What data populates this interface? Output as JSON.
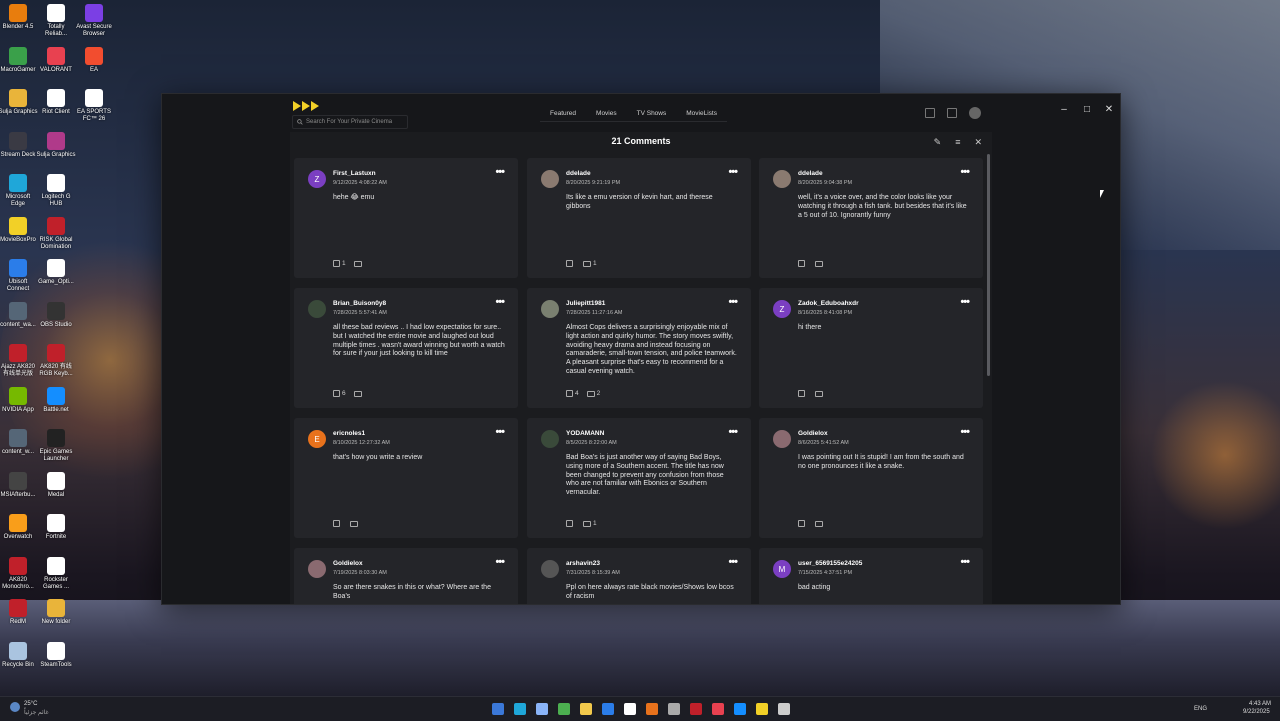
{
  "desktop_icons": [
    {
      "label": "Blender 4.5",
      "color": "#e87d0d"
    },
    {
      "label": "Totally Reliab...",
      "color": "#ffffff"
    },
    {
      "label": "Avast Secure Browser",
      "color": "#7b3fe4"
    },
    {
      "label": "MacroGamer",
      "color": "#3aa04a"
    },
    {
      "label": "VALORANT",
      "color": "#e84150"
    },
    {
      "label": "EA",
      "color": "#f24d2f"
    },
    {
      "label": "Sulja Graphics",
      "color": "#e9b43a"
    },
    {
      "label": "Riot Client",
      "color": "#ffffff"
    },
    {
      "label": "EA SPORTS FC™ 26",
      "color": "#ffffff"
    },
    {
      "label": "Stream Deck",
      "color": "#3a3a44"
    },
    {
      "label": "Sulja Graphics",
      "color": "#b03a8a"
    },
    {
      "label": "Microsoft Edge",
      "color": "#1fa7d9"
    },
    {
      "label": "Logitech G HUB",
      "color": "#ffffff"
    },
    {
      "label": "MovieBoxPro",
      "color": "#f2d027"
    },
    {
      "label": "RISK Global Domination",
      "color": "#c0202a"
    },
    {
      "label": "Ubisoft Connect",
      "color": "#2b7de9"
    },
    {
      "label": "Game_Opti...",
      "color": "#ffffff"
    },
    {
      "label": "content_wa...",
      "color": "#556677"
    },
    {
      "label": "OBS Studio",
      "color": "#333333"
    },
    {
      "label": "Ajazz AK820 有线单光版",
      "color": "#c0202a"
    },
    {
      "label": "AK820 有线 RGB Keyb...",
      "color": "#c0202a"
    },
    {
      "label": "NVIDIA App",
      "color": "#76b900"
    },
    {
      "label": "Battle.net",
      "color": "#148eff"
    },
    {
      "label": "content_w...",
      "color": "#556677"
    },
    {
      "label": "Epic Games Launcher",
      "color": "#222222"
    },
    {
      "label": "MSIAfterbu...",
      "color": "#444444"
    },
    {
      "label": "Medal",
      "color": "#ffffff"
    },
    {
      "label": "Overwatch",
      "color": "#f99e1a"
    },
    {
      "label": "Fortnite",
      "color": "#ffffff"
    },
    {
      "label": "AK820 Monochro...",
      "color": "#c0202a"
    },
    {
      "label": "Rockster Games ...",
      "color": "#ffffff"
    },
    {
      "label": "RedM",
      "color": "#c0202a"
    },
    {
      "label": "New folder",
      "color": "#e9b43a"
    },
    {
      "label": "Recycle Bin",
      "color": "#aac4e0"
    },
    {
      "label": "SteamTools",
      "color": "#ffffff"
    }
  ],
  "app": {
    "search_placeholder": "Search For Your Private Cinema",
    "nav_tabs": [
      "Featured",
      "Movies",
      "TV Shows",
      "MovieLists"
    ],
    "window_controls": {
      "minimize": "–",
      "maximize": "□",
      "close": "✕"
    },
    "accent": "#f2d027"
  },
  "comments_panel": {
    "title": "21 Comments",
    "icons": {
      "edit": "✎",
      "sort": "≡",
      "close": "✕"
    }
  },
  "comments": [
    {
      "user": "First_Lastuxn",
      "date": "9/12/2025 4:08:22 AM",
      "text": "hehe 😂 emu",
      "likes": "1",
      "replies": "",
      "avatar_letter": "Z",
      "avatar_color": "#7b3fc2"
    },
    {
      "user": "ddelade",
      "date": "8/20/2025 9:21:19 PM",
      "text": "Its like a emu version of kevin hart, and therese gibbons",
      "likes": "",
      "replies": "1",
      "avatar_letter": "",
      "avatar_color": "#8a7a70"
    },
    {
      "user": "ddelade",
      "date": "8/20/2025 9:04:38 PM",
      "text": "well, it's a voice over, and the color looks like your watching it through a fish tank. but besides that it's like a 5 out of 10. Ignorantly funny",
      "likes": "",
      "replies": "",
      "avatar_letter": "",
      "avatar_color": "#8a7a70"
    },
    {
      "user": "Brian_Buison0y8",
      "date": "7/28/2025 5:57:41 AM",
      "text": "all these bad reviews .. I had low expectatios  for sure.. but I watched the entire movie and laughed out loud multiple times . wasn't award winning but worth a watch for sure if your just looking to kill time",
      "likes": "6",
      "replies": "",
      "avatar_letter": "",
      "avatar_color": "#3a4a3a"
    },
    {
      "user": "Juliepitt1981",
      "date": "7/28/2025 11:27:16 AM",
      "text": "Almost Cops delivers a surprisingly enjoyable mix of light action and quirky humor. The story moves swiftly, avoiding heavy drama and instead focusing on camaraderie, small-town tension, and police teamwork. A pleasant surprise that's easy to recommend for a casual evening watch.",
      "likes": "4",
      "replies": "2",
      "avatar_letter": "",
      "avatar_color": "#7a8070"
    },
    {
      "user": "Zadok_Eduboahxdr",
      "date": "8/16/2025 8:41:08 PM",
      "text": "hi there",
      "likes": "",
      "replies": "",
      "avatar_letter": "Z",
      "avatar_color": "#7b3fc2"
    },
    {
      "user": "ericnoles1",
      "date": "8/10/2025 12:27:32 AM",
      "text": "that's how you write a review",
      "likes": "",
      "replies": "",
      "avatar_letter": "E",
      "avatar_color": "#e8721c"
    },
    {
      "user": "YODAMANN",
      "date": "8/5/2025 8:22:00 AM",
      "text": "Bad Boa's is just another way of saying Bad Boys, using more of a Southern accent. The title has now been changed to prevent any confusion from those who are not familiar with Ebonics or Southern vernacular.",
      "likes": "",
      "replies": "1",
      "avatar_letter": "",
      "avatar_color": "#3a4a3a"
    },
    {
      "user": "Goldielox",
      "date": "8/6/2025 5:41:52 AM",
      "text": "I was pointing out It is stupid! I am  from the south and no one pronounces it like a snake.",
      "likes": "",
      "replies": "",
      "avatar_letter": "",
      "avatar_color": "#8a6a70"
    },
    {
      "user": "Goldielox",
      "date": "7/19/2025 8:03:30 AM",
      "text": "So are there snakes in this or what? Where are the Boa's",
      "likes": "",
      "replies": "",
      "avatar_letter": "",
      "avatar_color": "#8a6a70"
    },
    {
      "user": "arshavin23",
      "date": "7/31/2025 8:15:39 AM",
      "text": "Ppl on here always rate black movies/Shows low bcos of racism",
      "likes": "",
      "replies": "",
      "avatar_letter": "",
      "avatar_color": "#555555"
    },
    {
      "user": "user_6569155e24205",
      "date": "7/15/2025 4:37:51 PM",
      "text": "bad acting",
      "likes": "",
      "replies": "",
      "avatar_letter": "M",
      "avatar_color": "#7b3fc2"
    }
  ],
  "taskbar": {
    "weather_temp": "25°C",
    "weather_desc": "غائم جزئياً",
    "lang": "ENG",
    "time": "4:43 AM",
    "date": "9/22/2025"
  }
}
